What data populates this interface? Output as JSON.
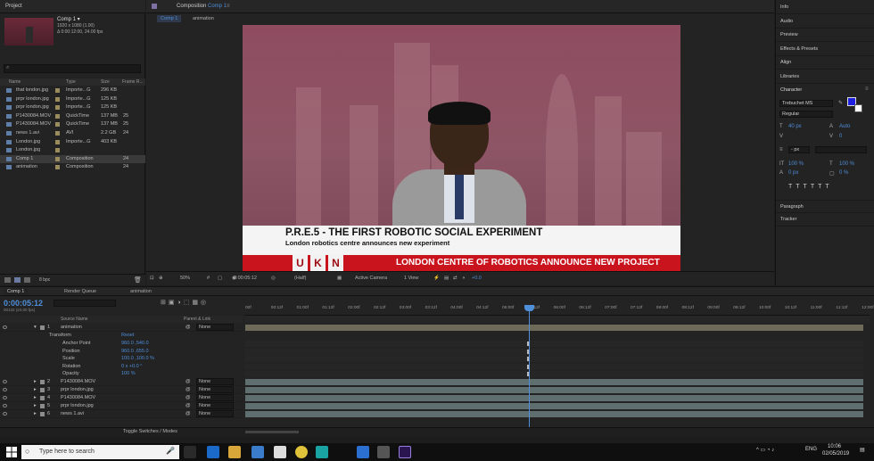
{
  "project": {
    "panel_title": "Project",
    "selected_name": "Comp 1 ▾",
    "selected_info1": "1920 x 1080 (1.00)",
    "selected_info2": "Δ 0:00:12:00, 24.00 fps",
    "headers": {
      "name": "Name",
      "type": "Type",
      "size": "Size",
      "frame": "Frame R..."
    },
    "items": [
      {
        "name": "that london.jpg",
        "type": "Importe...G",
        "size": "296 KB",
        "frame": ""
      },
      {
        "name": "prpr london.jpg",
        "type": "Importe...G",
        "size": "125 KB",
        "frame": ""
      },
      {
        "name": "prpr london.jpg",
        "type": "Importe...G",
        "size": "125 KB",
        "frame": ""
      },
      {
        "name": "P1430084.MOV",
        "type": "QuickTime",
        "size": "137 MB",
        "frame": "25"
      },
      {
        "name": "P1430084.MOV",
        "type": "QuickTime",
        "size": "137 MB",
        "frame": "25"
      },
      {
        "name": "news 1.avi",
        "type": "AVI",
        "size": "2.2 GB",
        "frame": "24"
      },
      {
        "name": "London.jpg",
        "type": "Importe...G",
        "size": "403 KB",
        "frame": ""
      },
      {
        "name": "London.jpg",
        "type": "",
        "size": "",
        "frame": ""
      },
      {
        "name": "Comp 1",
        "type": "Composition",
        "size": "",
        "frame": "24"
      },
      {
        "name": "animation",
        "type": "Composition",
        "size": "",
        "frame": "24"
      }
    ],
    "bpc": "8 bpc"
  },
  "viewer": {
    "tab_label": "Composition",
    "tab_comp": "Comp 1",
    "crumbs": [
      "Comp 1",
      "animation"
    ],
    "headline": "P.R.E.5 - THE FIRST ROBOTIC SOCIAL EXPERIMENT",
    "subline": "London robotics centre announces new experiment",
    "logo_letters": [
      "U",
      "K",
      "N"
    ],
    "ticker": "LONDON CENTRE OF ROBOTICS ANNOUNCE NEW PROJECT",
    "footer": {
      "zoom": "50%",
      "time": "0:00:05:12",
      "quality": "(Half)",
      "camera": "Active Camera",
      "views": "1 View",
      "exposure": "+0.0"
    }
  },
  "right": {
    "panels": [
      "Info",
      "Audio",
      "Preview",
      "Effects & Presets",
      "Align",
      "Libraries"
    ],
    "character": {
      "title": "Character",
      "font": "Trebuchet MS",
      "style": "Regular",
      "size": "40 px",
      "leading": "Auto",
      "kerning": "",
      "tracking": "0",
      "stroke": "- px",
      "vscale": "100 %",
      "hscale": "100 %",
      "baseline": "0 px",
      "tsume": "0 %",
      "fill_color": "#1f1fe0",
      "stroke_color": "#ffffff"
    },
    "lower_panels": [
      "Paragraph",
      "Tracker"
    ]
  },
  "timeline": {
    "tabs": [
      "Comp 1",
      "Render Queue",
      "animation"
    ],
    "timecode": "0:00:05:12",
    "timecode_sub": "00132 (24.00 fps)",
    "headers": {
      "source": "Source Name",
      "parent": "Parent & Link"
    },
    "layers": [
      {
        "num": "1",
        "name": "animation",
        "parent": "None"
      },
      {
        "num": "2",
        "name": "P1430084.MOV",
        "parent": "None"
      },
      {
        "num": "3",
        "name": "prpr london.jpg",
        "parent": "None"
      },
      {
        "num": "4",
        "name": "P1430084.MOV",
        "parent": "None"
      },
      {
        "num": "5",
        "name": "prpr london.jpg",
        "parent": "None"
      },
      {
        "num": "6",
        "name": "news 1.avi",
        "parent": "None"
      }
    ],
    "transform": {
      "label": "Transform",
      "reset": "Reset",
      "props": [
        {
          "name": "Anchor Point",
          "value": "960.0 ,540.0"
        },
        {
          "name": "Position",
          "value": "960.0 ,655.0"
        },
        {
          "name": "Scale",
          "value": "100.0 ,100.0 %"
        },
        {
          "name": "Rotation",
          "value": "0 x +0.0 °"
        },
        {
          "name": "Opacity",
          "value": "100 %"
        }
      ]
    },
    "ruler": [
      "00f",
      "00:12f",
      "01:00f",
      "01:12f",
      "02:00f",
      "02:12f",
      "03:00f",
      "03:12f",
      "04:00f",
      "04:12f",
      "05:00f",
      "05:12f",
      "06:00f",
      "06:12f",
      "07:00f",
      "07:12f",
      "08:00f",
      "08:12f",
      "09:00f",
      "09:12f",
      "10:00f",
      "10:12f",
      "11:00f",
      "11:12f",
      "12:00f"
    ],
    "footer": "Toggle Switches / Modes"
  },
  "taskbar": {
    "search": "Type here to search",
    "time": "10:06",
    "date": "02/05/2019",
    "lang": "ENG"
  }
}
